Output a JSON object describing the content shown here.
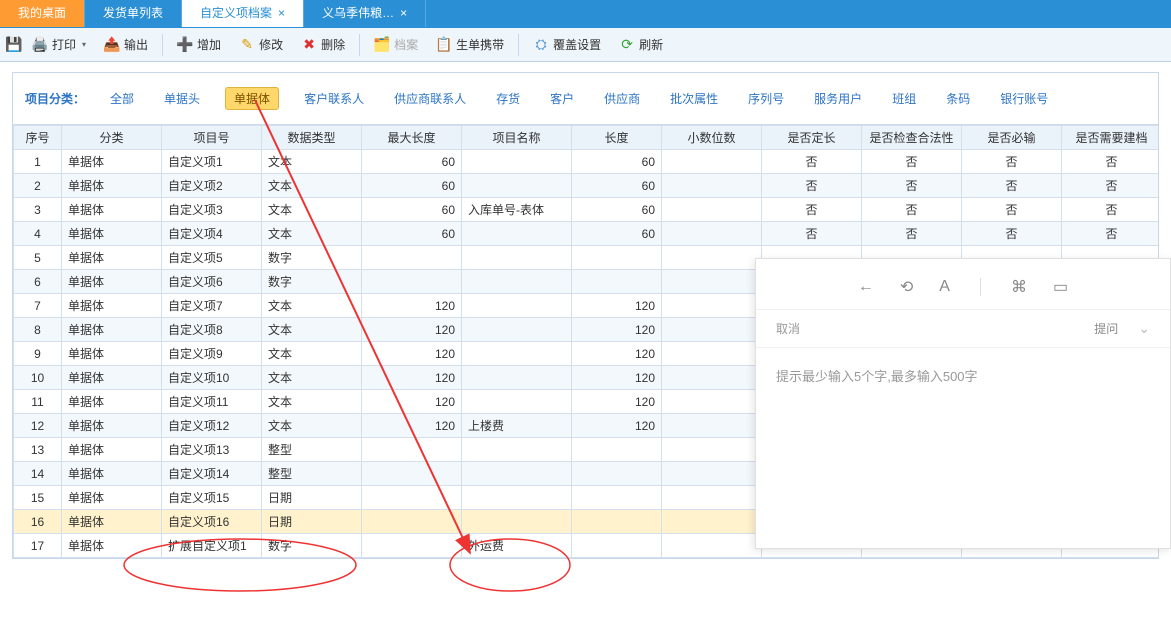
{
  "tabs": [
    {
      "label": "我的桌面",
      "active": false,
      "closeable": false,
      "orange": true
    },
    {
      "label": "发货单列表",
      "active": false,
      "closeable": false
    },
    {
      "label": "自定义项档案",
      "active": true,
      "closeable": true
    },
    {
      "label": "义乌季伟粮…",
      "active": false,
      "closeable": true
    }
  ],
  "toolbar": {
    "print": "打印",
    "export": "输出",
    "add": "增加",
    "edit": "修改",
    "delete": "删除",
    "archive": "档案",
    "carry": "生单携带",
    "cover": "覆盖设置",
    "refresh": "刷新"
  },
  "filters": {
    "label": "项目分类：",
    "items": [
      "全部",
      "单据头",
      "单据体",
      "客户联系人",
      "供应商联系人",
      "存货",
      "客户",
      "供应商",
      "批次属性",
      "序列号",
      "服务用户",
      "班组",
      "条码",
      "银行账号"
    ],
    "active": "单据体"
  },
  "columns": [
    "序号",
    "分类",
    "项目号",
    "数据类型",
    "最大长度",
    "项目名称",
    "长度",
    "小数位数",
    "是否定长",
    "是否检查合法性",
    "是否必输",
    "是否需要建档"
  ],
  "rows": [
    {
      "n": 1,
      "cat": "单据体",
      "id": "自定义项1",
      "type": "文本",
      "max": "60",
      "name": "",
      "len": "60",
      "dec": "",
      "fix": "否",
      "chk": "否",
      "req": "否",
      "arc": "否"
    },
    {
      "n": 2,
      "cat": "单据体",
      "id": "自定义项2",
      "type": "文本",
      "max": "60",
      "name": "",
      "len": "60",
      "dec": "",
      "fix": "否",
      "chk": "否",
      "req": "否",
      "arc": "否"
    },
    {
      "n": 3,
      "cat": "单据体",
      "id": "自定义项3",
      "type": "文本",
      "max": "60",
      "name": "入库单号-表体",
      "len": "60",
      "dec": "",
      "fix": "否",
      "chk": "否",
      "req": "否",
      "arc": "否"
    },
    {
      "n": 4,
      "cat": "单据体",
      "id": "自定义项4",
      "type": "文本",
      "max": "60",
      "name": "",
      "len": "60",
      "dec": "",
      "fix": "否",
      "chk": "否",
      "req": "否",
      "arc": "否"
    },
    {
      "n": 5,
      "cat": "单据体",
      "id": "自定义项5",
      "type": "数字",
      "max": "",
      "name": "",
      "len": "",
      "dec": "",
      "fix": "",
      "chk": "",
      "req": "",
      "arc": ""
    },
    {
      "n": 6,
      "cat": "单据体",
      "id": "自定义项6",
      "type": "数字",
      "max": "",
      "name": "",
      "len": "",
      "dec": "",
      "fix": "",
      "chk": "",
      "req": "",
      "arc": ""
    },
    {
      "n": 7,
      "cat": "单据体",
      "id": "自定义项7",
      "type": "文本",
      "max": "120",
      "name": "",
      "len": "120",
      "dec": "",
      "fix": "",
      "chk": "",
      "req": "",
      "arc": ""
    },
    {
      "n": 8,
      "cat": "单据体",
      "id": "自定义项8",
      "type": "文本",
      "max": "120",
      "name": "",
      "len": "120",
      "dec": "",
      "fix": "",
      "chk": "",
      "req": "",
      "arc": ""
    },
    {
      "n": 9,
      "cat": "单据体",
      "id": "自定义项9",
      "type": "文本",
      "max": "120",
      "name": "",
      "len": "120",
      "dec": "",
      "fix": "",
      "chk": "",
      "req": "",
      "arc": ""
    },
    {
      "n": 10,
      "cat": "单据体",
      "id": "自定义项10",
      "type": "文本",
      "max": "120",
      "name": "",
      "len": "120",
      "dec": "",
      "fix": "",
      "chk": "",
      "req": "",
      "arc": ""
    },
    {
      "n": 11,
      "cat": "单据体",
      "id": "自定义项11",
      "type": "文本",
      "max": "120",
      "name": "",
      "len": "120",
      "dec": "",
      "fix": "",
      "chk": "",
      "req": "",
      "arc": ""
    },
    {
      "n": 12,
      "cat": "单据体",
      "id": "自定义项12",
      "type": "文本",
      "max": "120",
      "name": "上楼费",
      "len": "120",
      "dec": "",
      "fix": "",
      "chk": "",
      "req": "",
      "arc": ""
    },
    {
      "n": 13,
      "cat": "单据体",
      "id": "自定义项13",
      "type": "整型",
      "max": "",
      "name": "",
      "len": "",
      "dec": "",
      "fix": "",
      "chk": "",
      "req": "",
      "arc": ""
    },
    {
      "n": 14,
      "cat": "单据体",
      "id": "自定义项14",
      "type": "整型",
      "max": "",
      "name": "",
      "len": "",
      "dec": "",
      "fix": "",
      "chk": "",
      "req": "",
      "arc": ""
    },
    {
      "n": 15,
      "cat": "单据体",
      "id": "自定义项15",
      "type": "日期",
      "max": "",
      "name": "",
      "len": "",
      "dec": "",
      "fix": "",
      "chk": "",
      "req": "",
      "arc": ""
    },
    {
      "n": 16,
      "cat": "单据体",
      "id": "自定义项16",
      "type": "日期",
      "max": "",
      "name": "",
      "len": "",
      "dec": "",
      "fix": "",
      "chk": "",
      "req": "",
      "arc": "",
      "selected": true
    },
    {
      "n": 17,
      "cat": "单据体",
      "id": "扩展自定义项1",
      "type": "数字",
      "max": "",
      "name": "外运费",
      "len": "",
      "dec": "",
      "fix": "",
      "chk": "",
      "req": "",
      "arc": ""
    }
  ],
  "panel": {
    "cancel": "取消",
    "ask": "提问",
    "hint": "提示最少输入5个字,最多输入500字"
  }
}
